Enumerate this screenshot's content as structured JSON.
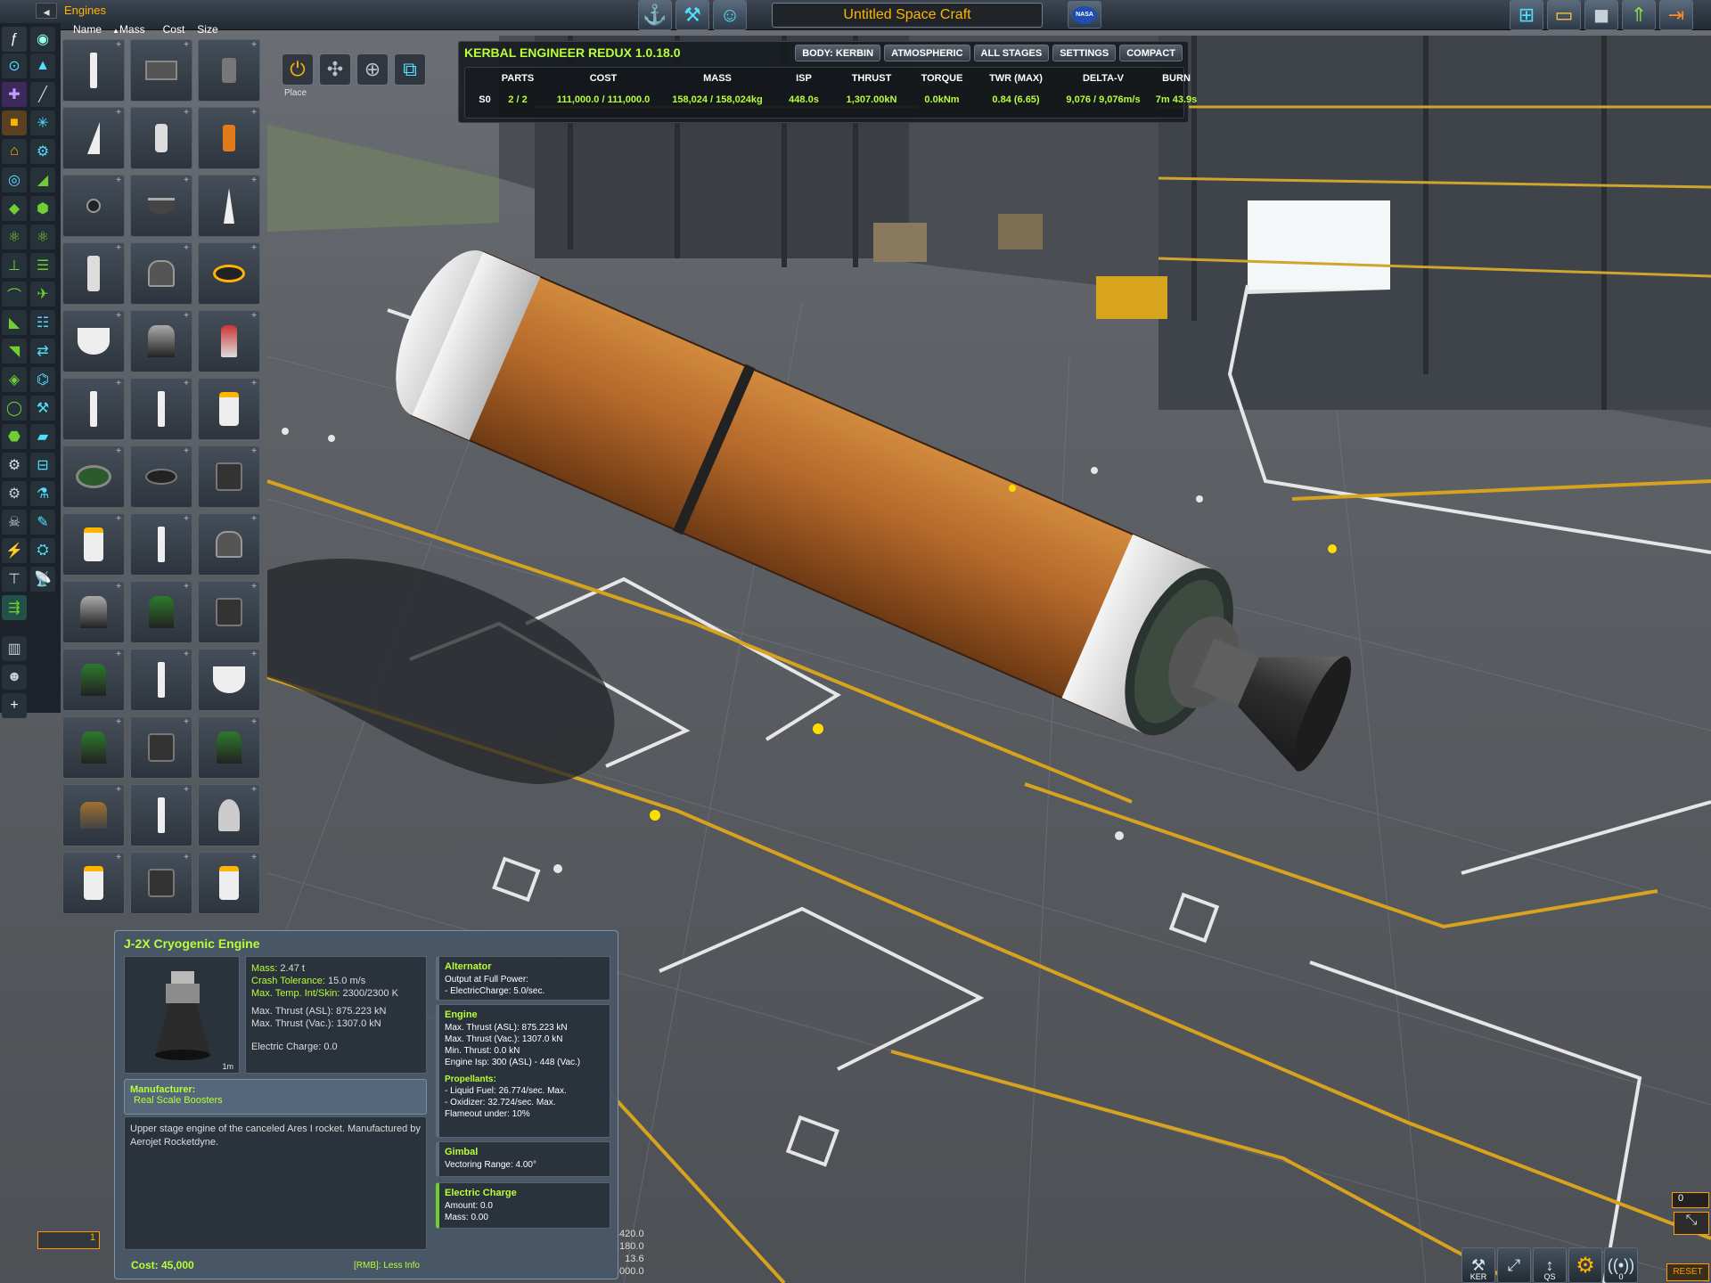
{
  "category": {
    "title": "Engines",
    "collapse_glyph": "◂"
  },
  "sort": {
    "name": "Name",
    "mass": "Mass",
    "mass_arrow": "▲",
    "cost": "Cost",
    "size": "Size"
  },
  "craft_name": "Untitled Space Craft",
  "flag_text": "NASA",
  "tools": {
    "place_label": "Place"
  },
  "ker": {
    "title": "KERBAL ENGINEER REDUX 1.0.18.0",
    "buttons": [
      "BODY: KERBIN",
      "ATMOSPHERIC",
      "ALL STAGES",
      "SETTINGS",
      "COMPACT"
    ],
    "headers": [
      "PARTS",
      "COST",
      "MASS",
      "ISP",
      "THRUST",
      "TORQUE",
      "TWR (MAX)",
      "DELTA-V",
      "BURN"
    ],
    "stage": "S0",
    "row": [
      "2 / 2",
      "111,000.0 / 111,000.0",
      "158,024 / 158,024kg",
      "448.0s",
      "1,307.00kN",
      "0.0kNm",
      "0.84 (6.65)",
      "9,076 / 9,076m/s",
      "7m 43.9s"
    ]
  },
  "tooltip": {
    "title": "J-2X Cryogenic Engine",
    "size": "1m",
    "mass_label": "Mass:",
    "mass": "2.47 t",
    "crash_label": "Crash Tolerance:",
    "crash": "15.0 m/s",
    "temp_label": "Max. Temp. Int/Skin:",
    "temp": "2300/2300 K",
    "thrust_asl_label": "Max. Thrust (ASL):",
    "thrust_asl": "875.223 kN",
    "thrust_vac_label": "Max. Thrust (Vac.):",
    "thrust_vac": "1307.0 kN",
    "ec_label": "Electric Charge:",
    "ec": "0.0",
    "manufacturer_label": "Manufacturer:",
    "manufacturer": "Real Scale Boosters",
    "description": "Upper stage engine of the canceled Ares I rocket. Manufactured by Aerojet Rocketdyne.",
    "cost": "Cost: 45,000",
    "rmb": "[RMB]: Less Info",
    "modules": {
      "alternator": {
        "title": "Alternator",
        "l1": "Output at Full Power:",
        "l2": "- ElectricCharge: 5.0/sec."
      },
      "engine": {
        "title": "Engine",
        "l1": "Max. Thrust (ASL): 875.223 kN",
        "l2": "Max. Thrust (Vac.): 1307.0 kN",
        "l3": "Min. Thrust: 0.0 kN",
        "l4": "Engine Isp: 300 (ASL) - 448 (Vac.)",
        "prop": "Propellants:",
        "l5": "- Liquid Fuel: 26.774/sec. Max.",
        "l6": "- Oxidizer: 32.724/sec. Max.",
        "l7": "Flameout under: 10%"
      },
      "gimbal": {
        "title": "Gimbal",
        "l1": "Vectoring Range: 4.00°"
      },
      "electric": {
        "title": "Electric Charge",
        "l1": "Amount: 0.0",
        "l2": "Mass: 0.00"
      }
    }
  },
  "bottom": {
    "counter": "0",
    "reset": "RESET",
    "ker_label": "KER",
    "qs_label": "QS",
    "antenna_count": "0",
    "left_value": "1",
    "bg_numbers": [
      ",420.0",
      ",180.0",
      "13.6",
      ",000.0"
    ]
  },
  "colors": {
    "accent_green": "#b8ff39",
    "accent_orange": "#ffb400",
    "cyan": "#4fe0ff",
    "tank": "#b4682a"
  }
}
